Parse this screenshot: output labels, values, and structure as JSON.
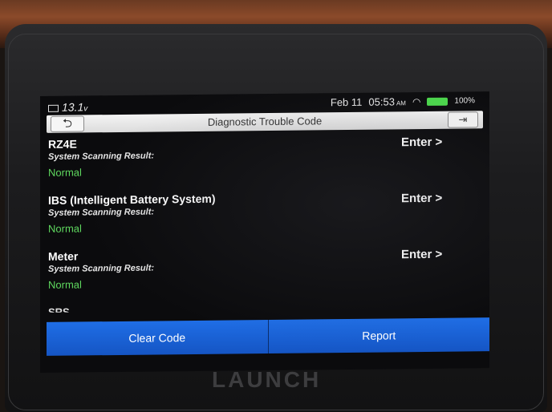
{
  "status_bar": {
    "voltage": "13.1",
    "voltage_unit": "v",
    "date": "Feb 11",
    "time": "05:53",
    "ampm": "AM",
    "battery": "100%"
  },
  "titlebar": {
    "title": "Diagnostic Trouble Code",
    "back_icon": "back-arrow-icon",
    "exit_icon": "exit-icon"
  },
  "systems": [
    {
      "name": "RZ4E",
      "label": "System Scanning Result:",
      "status": "Normal",
      "action": "Enter >"
    },
    {
      "name": "IBS (Intelligent Battery System)",
      "label": "System Scanning Result:",
      "status": "Normal",
      "action": "Enter >"
    },
    {
      "name": "Meter",
      "label": "System Scanning Result:",
      "status": "Normal",
      "action": "Enter >"
    }
  ],
  "partial_item": "SRS",
  "buttons": {
    "clear_code": "Clear Code",
    "report": "Report"
  },
  "device": {
    "brand": "LAUNCH"
  },
  "colors": {
    "status_normal": "#5fd85f",
    "button_blue": "#1f6ee6"
  }
}
